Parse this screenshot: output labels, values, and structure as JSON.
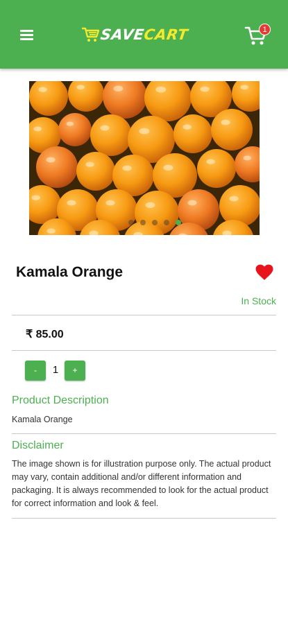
{
  "header": {
    "logo_part1": "SAVE",
    "logo_part2": "CART",
    "cart_count": "1",
    "icons": [
      "menu-icon",
      "logo-cart-icon",
      "cart-icon"
    ],
    "colors": {
      "primary": "#4caf50",
      "logo_accent": "#f3ea2e",
      "badge": "#e53935"
    }
  },
  "gallery": {
    "slide_count": 5,
    "active_index": 4
  },
  "product": {
    "name": "Kamala Orange",
    "favorite": true,
    "stock_status": "In Stock",
    "price": "₹ 85.00",
    "quantity": "1",
    "minus_label": "-",
    "plus_label": "+"
  },
  "description": {
    "heading": "Product Description",
    "text": "Kamala Orange"
  },
  "disclaimer": {
    "heading": "Disclaimer",
    "text": "The image shown is for illustration purpose only. The actual product may vary, contain additional and/or different information and packaging. It is always recommended to look for the actual product for correct information and look & feel."
  }
}
